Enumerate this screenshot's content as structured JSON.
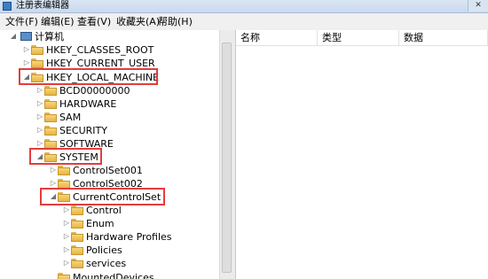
{
  "window": {
    "title": "注册表编辑器",
    "close_glyph": "✕"
  },
  "menu": {
    "items": [
      "文件(F)",
      "编辑(E)",
      "查看(V)",
      "收藏夹(A)",
      "帮助(H)"
    ]
  },
  "tree": {
    "root": "计算机",
    "nodes": [
      "HKEY_CLASSES_ROOT",
      "HKEY_CURRENT_USER",
      "HKEY_LOCAL_MACHINE",
      "BCD00000000",
      "HARDWARE",
      "SAM",
      "SECURITY",
      "SOFTWARE",
      "SYSTEM",
      "ControlSet001",
      "ControlSet002",
      "CurrentControlSet",
      "Control",
      "Enum",
      "Hardware Profiles",
      "Policies",
      "services",
      "MountedDevices"
    ],
    "expanded_glyph": "◢",
    "collapsed_glyph": "▷"
  },
  "list": {
    "columns": [
      "名称",
      "类型",
      "数据"
    ]
  },
  "colors": {
    "highlight_border": "#e23d3d",
    "folder": "#f0c75e"
  }
}
